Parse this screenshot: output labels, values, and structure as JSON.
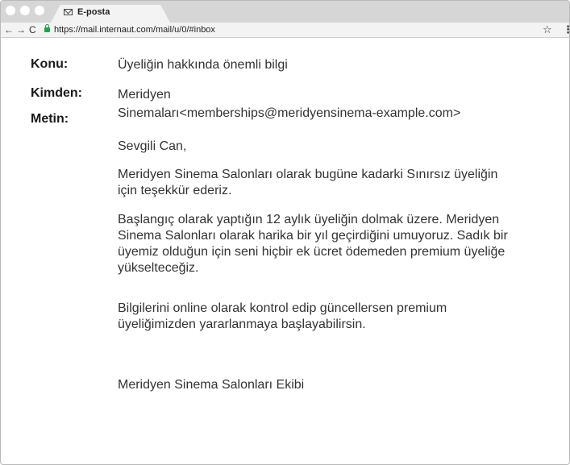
{
  "browser": {
    "tab_title": "E-posta",
    "url": "https://mail.internaut.com/mail/u/0/#inbox",
    "back": "←",
    "forward": "→",
    "reload": "C",
    "star": "☆",
    "menu": "⋮"
  },
  "email": {
    "subject_label": "Konu:",
    "subject": "Üyeliğin hakkında önemli bilgi",
    "from_label": "Kimden:",
    "from_line1": "Meridyen",
    "from_line2": "Sinemaları<memberships@meridyensinema-example.com>",
    "body_label": "Metin:",
    "greeting": "Sevgili Can,",
    "para1": "Meridyen Sinema Salonları olarak bugüne kadarki Sınırsız üyeliğin için teşekkür ederiz.",
    "para2": "Başlangıç olarak yaptığın 12 aylık üyeliğin dolmak üzere. Meridyen Sinema Salonları olarak harika bir yıl geçirdiğini umuyoruz. Sadık bir üyemiz olduğun için seni hiçbir ek ücret ödemeden premium üyeliğe yükselteceğiz.",
    "para3": "Bilgilerini online olarak kontrol edip güncellersen premium üyeliğimizden yararlanmaya başlayabilirsin.",
    "signature": "Meridyen Sinema Salonları Ekibi"
  }
}
